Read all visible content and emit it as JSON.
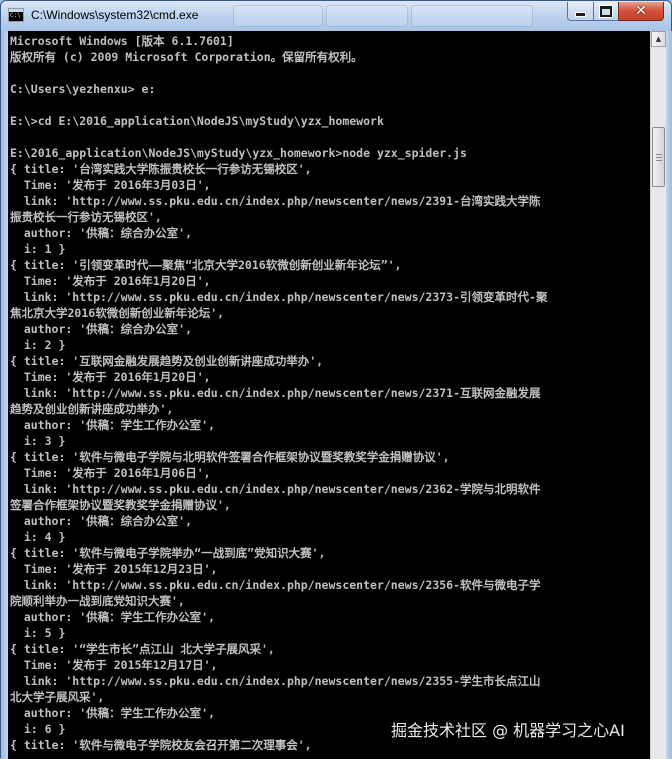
{
  "window": {
    "title": "C:\\Windows\\system32\\cmd.exe",
    "minimize_icon": "minimize-icon",
    "maximize_icon": "maximize-icon",
    "close_icon": "close-icon",
    "close_glyph": "✕"
  },
  "console": {
    "lines": [
      "Microsoft Windows [版本 6.1.7601]",
      "版权所有 (c) 2009 Microsoft Corporation。保留所有权利。",
      "",
      "C:\\Users\\yezhenxu> e:",
      "",
      "E:\\>cd E:\\2016_application\\NodeJS\\myStudy\\yzx_homework",
      "",
      "E:\\2016_application\\NodeJS\\myStudy\\yzx_homework>node yzx_spider.js",
      "{ title: '台湾实践大学陈振贵校长一行参访无锡校区',",
      "  Time: '发布于 2016年3月03日',",
      "  link: 'http://www.ss.pku.edu.cn/index.php/newscenter/news/2391-台湾实践大学陈",
      "振贵校长一行参访无锡校区',",
      "  author: '供稿：综合办公室',",
      "  i: 1 }",
      "{ title: '引领变革时代——聚焦“北京大学2016软微创新创业新年论坛”',",
      "  Time: '发布于 2016年1月20日',",
      "  link: 'http://www.ss.pku.edu.cn/index.php/newscenter/news/2373-引领变革时代-聚",
      "焦北京大学2016软微创新创业新年论坛',",
      "  author: '供稿：综合办公室',",
      "  i: 2 }",
      "{ title: '互联网金融发展趋势及创业创新讲座成功举办',",
      "  Time: '发布于 2016年1月20日',",
      "  link: 'http://www.ss.pku.edu.cn/index.php/newscenter/news/2371-互联网金融发展",
      "趋势及创业创新讲座成功举办',",
      "  author: '供稿：学生工作办公室',",
      "  i: 3 }",
      "{ title: '软件与微电子学院与北明软件签署合作框架协议暨奖教奖学金捐赠协议',",
      "  Time: '发布于 2016年1月06日',",
      "  link: 'http://www.ss.pku.edu.cn/index.php/newscenter/news/2362-学院与北明软件",
      "签署合作框架协议暨奖教奖学金捐赠协议',",
      "  author: '供稿：综合办公室',",
      "  i: 4 }",
      "{ title: '软件与微电子学院举办“一战到底”党知识大赛',",
      "  Time: '发布于 2015年12月23日',",
      "  link: 'http://www.ss.pku.edu.cn/index.php/newscenter/news/2356-软件与微电子学",
      "院顺利举办一战到底党知识大赛',",
      "  author: '供稿：学生工作办公室',",
      "  i: 5 }",
      "{ title: '“学生市长”点江山 北大学子展风采',",
      "  Time: '发布于 2015年12月17日',",
      "  link: 'http://www.ss.pku.edu.cn/index.php/newscenter/news/2355-学生市长点江山",
      "北大学子展风采',",
      "  author: '供稿：学生工作办公室',",
      "  i: 6 }",
      "{ title: '软件与微电子学院校友会召开第二次理事会',"
    ]
  },
  "scrollbar": {
    "up_arrow": "▲"
  },
  "watermark": "掘金技术社区 @ 机器学习之心AI"
}
